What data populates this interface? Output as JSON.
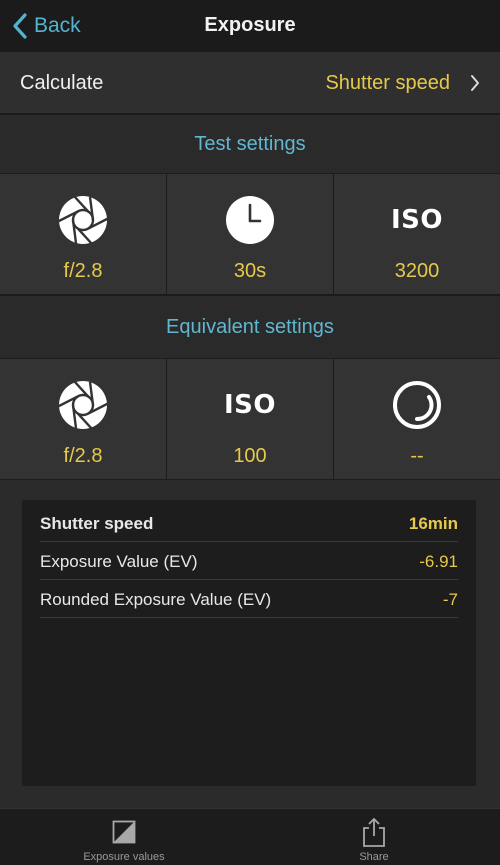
{
  "nav": {
    "back_label": "Back",
    "title": "Exposure"
  },
  "calculate": {
    "label": "Calculate",
    "value": "Shutter speed"
  },
  "test_settings": {
    "title": "Test settings",
    "cells": [
      {
        "icon": "aperture-icon",
        "value": "f/2.8"
      },
      {
        "icon": "clock-icon",
        "value": "30s"
      },
      {
        "icon": "iso-icon",
        "icon_text": "ISO",
        "value": "3200"
      }
    ]
  },
  "equivalent_settings": {
    "title": "Equivalent settings",
    "cells": [
      {
        "icon": "aperture-icon",
        "value": "f/2.8"
      },
      {
        "icon": "iso-icon",
        "icon_text": "ISO",
        "value": "100"
      },
      {
        "icon": "shutter-dial-icon",
        "value": "--"
      }
    ]
  },
  "results": [
    {
      "label": "Shutter speed",
      "value": "16min"
    },
    {
      "label": "Exposure Value (EV)",
      "value": "-6.91"
    },
    {
      "label": "Rounded Exposure Value (EV)",
      "value": "-7"
    }
  ],
  "tabbar": [
    {
      "icon": "exposure-values-icon",
      "label": "Exposure values"
    },
    {
      "icon": "share-icon",
      "label": "Share"
    }
  ],
  "colors": {
    "accent_blue": "#55b3cf",
    "value_yellow": "#e6c94a",
    "background": "#1b1b1b"
  }
}
